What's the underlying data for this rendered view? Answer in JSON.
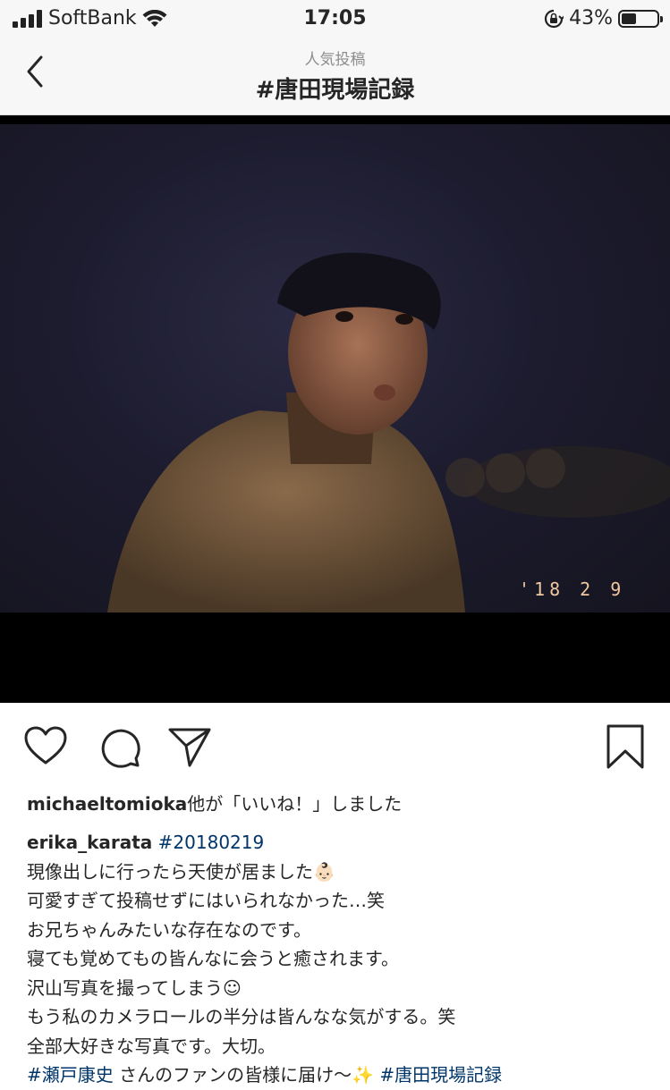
{
  "status_bar": {
    "carrier": "SoftBank",
    "time": "17:05",
    "battery_percent": "43%",
    "battery_level": 0.43
  },
  "nav": {
    "subtitle": "人気投稿",
    "title": "#唐田現場記録"
  },
  "photo": {
    "date_stamp": "'18 2 9"
  },
  "likes": {
    "user": "michaeltomioka",
    "suffix": "他が「いいね！」しました"
  },
  "caption": {
    "username": "erika_karata",
    "hashtag": "#20180219",
    "lines": [
      "現像出しに行ったら天使が居ました👶🏻",
      "可愛すぎて投稿せずにはいられなかった…笑",
      "お兄ちゃんみたいな存在なのです。",
      "寝ても覚めてもの皆んなに会うと癒されます。",
      "沢山写真を撮ってしまう☺︎",
      "もう私のカメラロールの半分は皆んなな気がする。笑",
      "全部大好きな写真です。大切。"
    ],
    "last_tag_1": "#瀬戸康史",
    "last_middle": " さんのファンの皆様に届け〜✨ ",
    "last_tag_2": "#唐田現場記録"
  },
  "icons": {
    "signal": "signal-icon",
    "wifi": "wifi-icon",
    "rotation_lock": "rotation-lock-icon",
    "battery": "battery-icon",
    "back": "back-chevron-icon",
    "like": "heart-icon",
    "comment": "comment-icon",
    "share": "paper-plane-icon",
    "save": "bookmark-icon"
  }
}
